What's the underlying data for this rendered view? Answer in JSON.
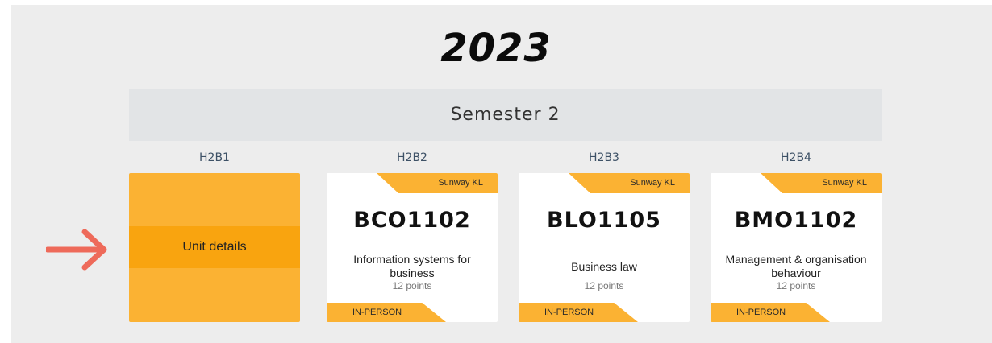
{
  "year": "2023",
  "semester": "Semester 2",
  "columns": [
    {
      "heading": "H2B1"
    },
    {
      "heading": "H2B2",
      "campus": "Sunway KL",
      "code": "BCO1102",
      "title": "Information systems for business",
      "points": "12 points",
      "delivery": "IN-PERSON"
    },
    {
      "heading": "H2B3",
      "campus": "Sunway KL",
      "code": "BLO1105",
      "title": "Business law",
      "points": "12 points",
      "delivery": "IN-PERSON"
    },
    {
      "heading": "H2B4",
      "campus": "Sunway KL",
      "code": "BMO1102",
      "title": "Management & organisation behaviour",
      "points": "12 points",
      "delivery": "IN-PERSON"
    }
  ],
  "selected_card": {
    "label": "Unit details",
    "color": "#fbb233",
    "band_color": "#f9a40f"
  },
  "pointer": {
    "icon": "right-arrow-icon",
    "color": "#ee6a5a"
  }
}
